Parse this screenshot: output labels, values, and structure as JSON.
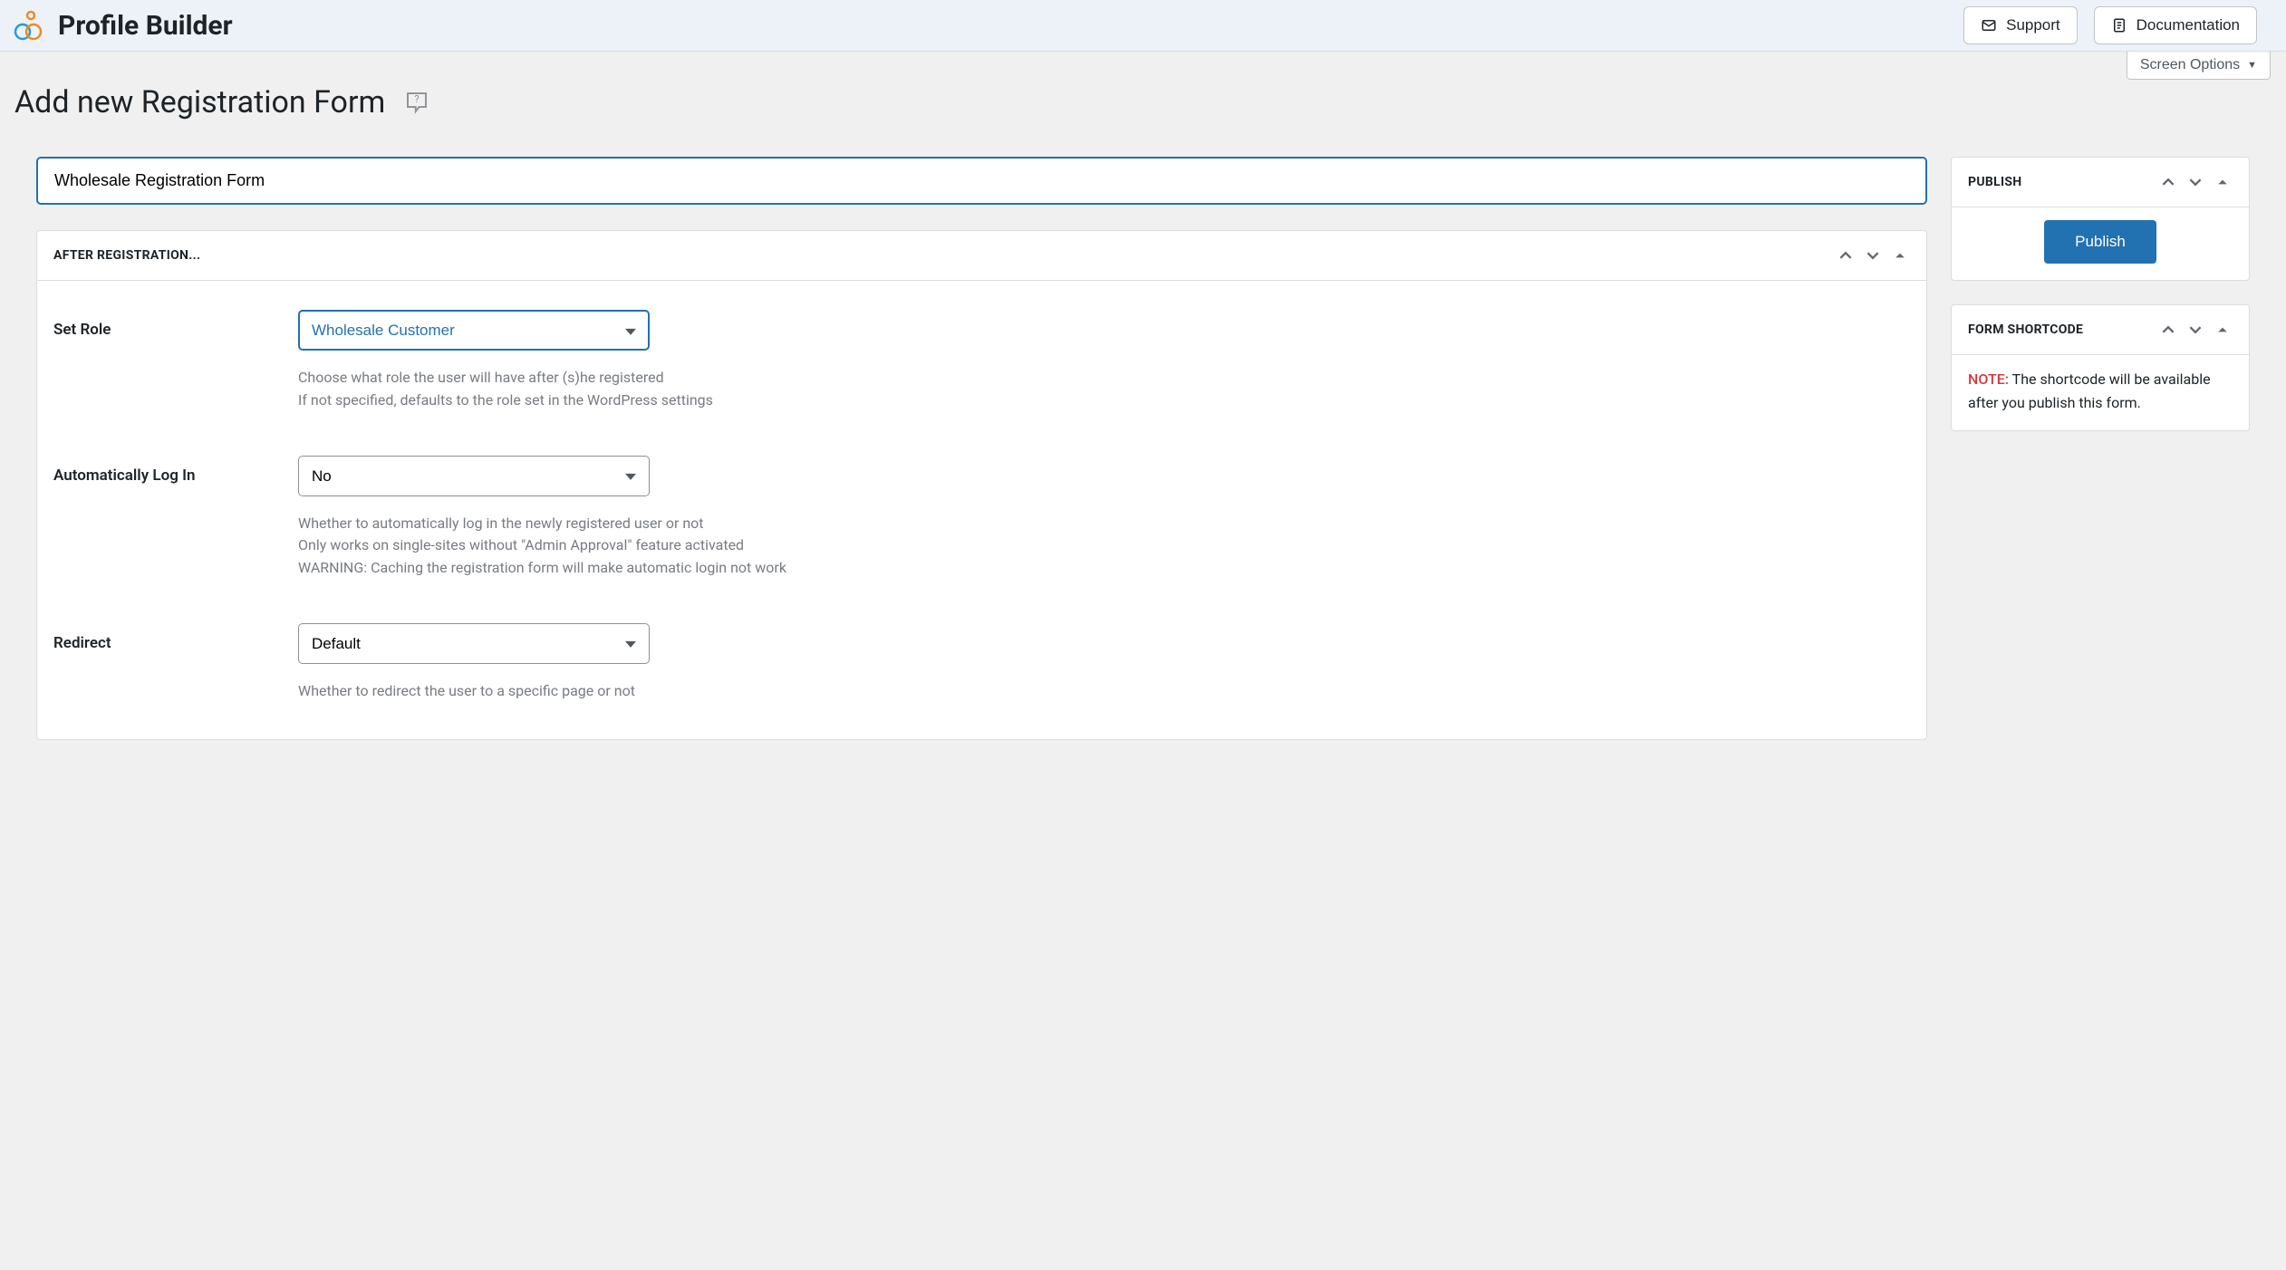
{
  "header": {
    "app_title": "Profile Builder",
    "support_label": "Support",
    "documentation_label": "Documentation"
  },
  "screen_options_label": "Screen Options",
  "page_title": "Add new Registration Form",
  "title_input_value": "Wholesale Registration Form",
  "after_registration": {
    "panel_title": "AFTER REGISTRATION...",
    "fields": {
      "set_role": {
        "label": "Set Role",
        "value": "Wholesale Customer",
        "desc_line1": "Choose what role the user will have after (s)he registered",
        "desc_line2": "If not specified, defaults to the role set in the WordPress settings"
      },
      "auto_login": {
        "label": "Automatically Log In",
        "value": "No",
        "desc_line1": "Whether to automatically log in the newly registered user or not",
        "desc_line2": "Only works on single-sites without \"Admin Approval\" feature activated",
        "desc_line3": "WARNING: Caching the registration form will make automatic login not work"
      },
      "redirect": {
        "label": "Redirect",
        "value": "Default",
        "desc_line1": "Whether to redirect the user to a specific page or not"
      }
    }
  },
  "publish": {
    "panel_title": "PUBLISH",
    "button_label": "Publish"
  },
  "shortcode": {
    "panel_title": "FORM SHORTCODE",
    "note_label": "NOTE:",
    "note_text": " The shortcode will be available after you publish this form."
  }
}
